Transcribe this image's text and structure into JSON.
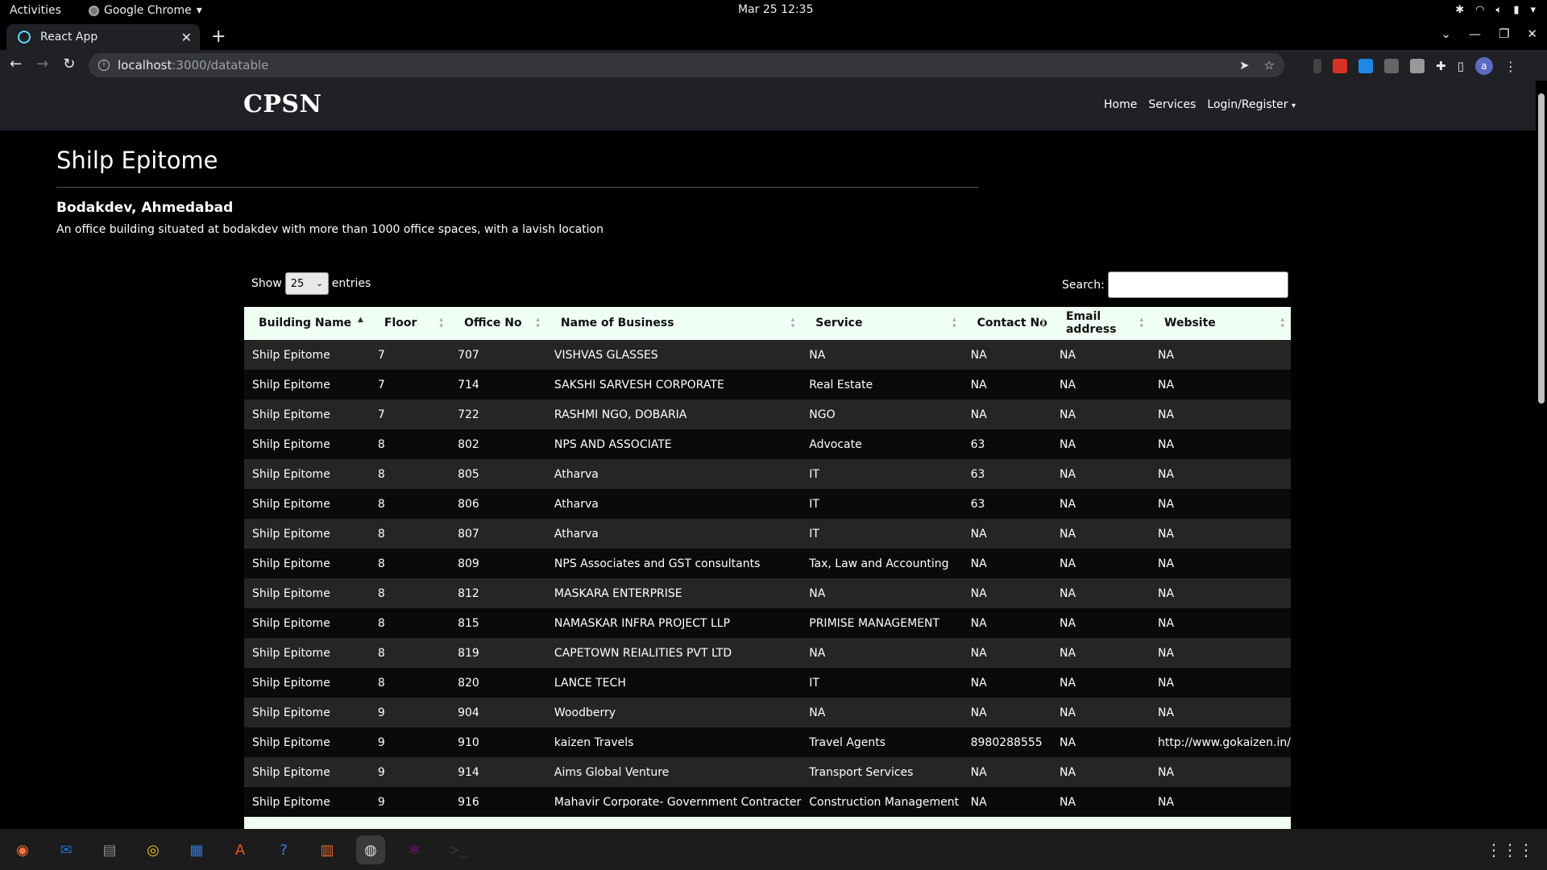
{
  "system": {
    "activities": "Activities",
    "app_name": "Google Chrome",
    "clock": "Mar 25  12:35"
  },
  "browser": {
    "tab_title": "React App",
    "url_host": "localhost",
    "url_path": ":3000/datatable",
    "profile_initial": "a"
  },
  "site": {
    "brand": "CPSN",
    "nav": [
      "Home",
      "Services",
      "Login/Register"
    ]
  },
  "building": {
    "title": "Shilp Epitome",
    "location": "Bodakdev, Ahmedabad",
    "description": "An office building situated at bodakdev with more than 1000 office spaces, with a lavish location"
  },
  "datatable": {
    "show_label": "Show",
    "entries_value": "25",
    "entries_label": "entries",
    "search_label": "Search:",
    "search_value": "",
    "columns": [
      "Building Name",
      "Floor",
      "Office No",
      "Name of Business",
      "Service",
      "Contact No",
      "Email address",
      "Website"
    ],
    "rows": [
      [
        "Shilp Epitome",
        "7",
        "707",
        "VISHVAS GLASSES",
        "NA",
        "NA",
        "NA",
        "NA"
      ],
      [
        "Shilp Epitome",
        "7",
        "714",
        "SAKSHI SARVESH CORPORATE",
        "Real Estate",
        "NA",
        "NA",
        "NA"
      ],
      [
        "Shilp Epitome",
        "7",
        "722",
        "RASHMI NGO, DOBARIA",
        "NGO",
        "NA",
        "NA",
        "NA"
      ],
      [
        "Shilp Epitome",
        "8",
        "802",
        "NPS AND ASSOCIATE",
        "Advocate",
        "63",
        "NA",
        "NA"
      ],
      [
        "Shilp Epitome",
        "8",
        "805",
        "Atharva",
        "IT",
        "63",
        "NA",
        "NA"
      ],
      [
        "Shilp Epitome",
        "8",
        "806",
        "Atharva",
        "IT",
        "63",
        "NA",
        "NA"
      ],
      [
        "Shilp Epitome",
        "8",
        "807",
        "Atharva",
        "IT",
        "NA",
        "NA",
        "NA"
      ],
      [
        "Shilp Epitome",
        "8",
        "809",
        "NPS Associates and GST consultants",
        "Tax, Law and Accounting",
        "NA",
        "NA",
        "NA"
      ],
      [
        "Shilp Epitome",
        "8",
        "812",
        "MASKARA ENTERPRISE",
        "NA",
        "NA",
        "NA",
        "NA"
      ],
      [
        "Shilp Epitome",
        "8",
        "815",
        "NAMASKAR INFRA PROJECT LLP",
        "PRIMISE MANAGEMENT",
        "NA",
        "NA",
        "NA"
      ],
      [
        "Shilp Epitome",
        "8",
        "819",
        "CAPETOWN REIALITIES PVT LTD",
        "NA",
        "NA",
        "NA",
        "NA"
      ],
      [
        "Shilp Epitome",
        "8",
        "820",
        "LANCE TECH",
        "IT",
        "NA",
        "NA",
        "NA"
      ],
      [
        "Shilp Epitome",
        "9",
        "904",
        "Woodberry",
        "NA",
        "NA",
        "NA",
        "NA"
      ],
      [
        "Shilp Epitome",
        "9",
        "910",
        "kaizen Travels",
        "Travel Agents",
        "8980288555",
        "NA",
        "http://www.gokaizen.in/"
      ],
      [
        "Shilp Epitome",
        "9",
        "914",
        "Aims Global Venture",
        "Transport Services",
        "NA",
        "NA",
        "NA"
      ],
      [
        "Shilp Epitome",
        "9",
        "916",
        "Mahavir Corporate- Government Contracter",
        "Construction Management",
        "NA",
        "NA",
        "NA"
      ]
    ]
  },
  "icons": {
    "tray": [
      "slack-icon",
      "wifi-icon",
      "volume-icon",
      "battery-icon",
      "power-menu-icon"
    ],
    "dock": [
      "firefox-icon",
      "thunderbird-icon",
      "files-icon",
      "rhythmbox-icon",
      "writer-icon",
      "software-icon",
      "help-icon",
      "document-viewer-icon",
      "chrome-icon",
      "slack-icon",
      "terminal-icon"
    ]
  }
}
